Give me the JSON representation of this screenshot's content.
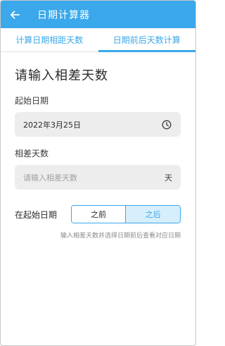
{
  "appbar": {
    "title": "日期计算器",
    "back_icon": "arrow-left-icon"
  },
  "tabs": [
    {
      "label": "计算日期相距天数",
      "active": false
    },
    {
      "label": "日期前后天数计算",
      "active": true
    }
  ],
  "form": {
    "section_title": "请输入相差天数",
    "start_date": {
      "label": "起始日期",
      "value": "2022年3月25日",
      "icon": "clock-icon"
    },
    "diff_days": {
      "label": "相差天数",
      "placeholder": "请输入相差天数",
      "suffix": "天"
    },
    "direction": {
      "label": "在起始日期",
      "options": [
        "之前",
        "之后"
      ],
      "selected": "之后"
    },
    "hint": "输入相差天数并选择日期前后查看对应日期"
  },
  "colors": {
    "accent": "#3aa8ea",
    "field_bg": "#ededed",
    "selected_bg": "#d7eefc"
  }
}
